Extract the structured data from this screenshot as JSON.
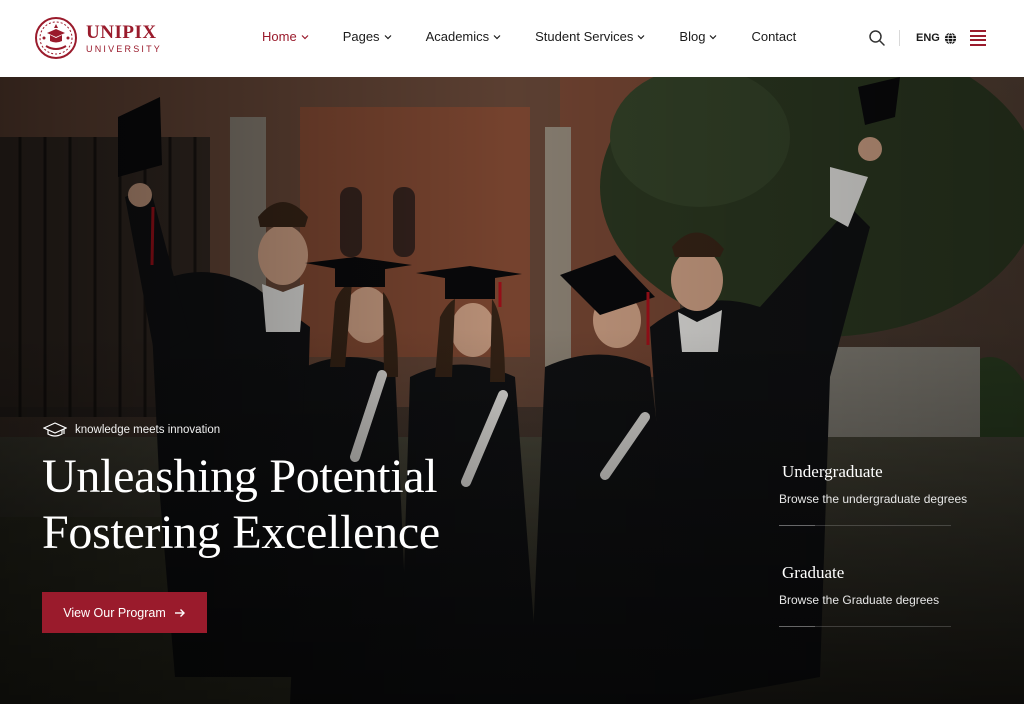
{
  "brand": {
    "name": "UNIPIX",
    "subtitle": "UNIVERSITY",
    "color": "#9a1b2c"
  },
  "nav": {
    "items": [
      {
        "label": "Home",
        "has_dropdown": true,
        "active": true
      },
      {
        "label": "Pages",
        "has_dropdown": true,
        "active": false
      },
      {
        "label": "Academics",
        "has_dropdown": true,
        "active": false
      },
      {
        "label": "Student Services",
        "has_dropdown": true,
        "active": false
      },
      {
        "label": "Blog",
        "has_dropdown": true,
        "active": false
      },
      {
        "label": "Contact",
        "has_dropdown": false,
        "active": false
      }
    ]
  },
  "header_actions": {
    "search_icon": "search-icon",
    "language": "ENG",
    "language_icon": "globe-icon",
    "menu_icon": "hamburger-menu-icon"
  },
  "hero": {
    "tagline": "knowledge meets innovation",
    "tagline_icon": "graduation-cap-icon",
    "headline_line1": "Unleashing Potential",
    "headline_line2": "Fostering Excellence",
    "cta_label": "View Our Program",
    "cta_icon": "arrow-right-icon",
    "side_links": [
      {
        "title": "Undergraduate",
        "description": "Browse the undergraduate degrees"
      },
      {
        "title": "Graduate",
        "description": "Browse the Graduate degrees"
      }
    ]
  }
}
